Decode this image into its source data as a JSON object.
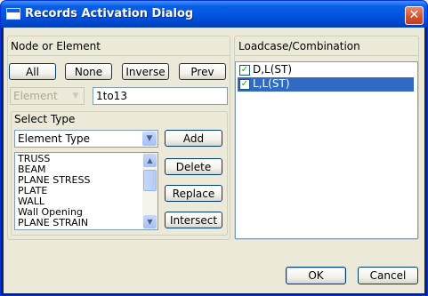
{
  "window": {
    "title": "Records Activation Dialog",
    "close_glyph": "✕"
  },
  "node_or_element": {
    "header": "Node or Element",
    "buttons": {
      "all": "All",
      "none": "None",
      "inverse": "Inverse",
      "prev": "Prev"
    },
    "type_combo": {
      "value": "Element",
      "enabled": false
    },
    "range_input": {
      "value": "1to13"
    }
  },
  "select_type": {
    "header": "Select Type",
    "combo": {
      "value": "Element Type"
    },
    "list_items": [
      "TRUSS",
      "BEAM",
      "PLANE STRESS",
      "PLATE",
      "WALL",
      "Wall Opening",
      "PLANE STRAIN"
    ],
    "buttons": {
      "add": "Add",
      "delete": "Delete",
      "replace": "Replace",
      "intersect": "Intersect"
    }
  },
  "loadcase": {
    "header": "Loadcase/Combination",
    "items": [
      {
        "label": "D,L(ST)",
        "checked": true,
        "selected": false
      },
      {
        "label": "L,L(ST)",
        "checked": true,
        "selected": true
      }
    ]
  },
  "footer": {
    "ok": "OK",
    "cancel": "Cancel"
  },
  "colors": {
    "titlebar": "#0054e3",
    "selection": "#316ac5",
    "dialog_bg": "#ece9d8"
  },
  "icons": {
    "close": "close-icon",
    "check": "checkmark-icon",
    "dropdown": "chevron-down-icon"
  }
}
